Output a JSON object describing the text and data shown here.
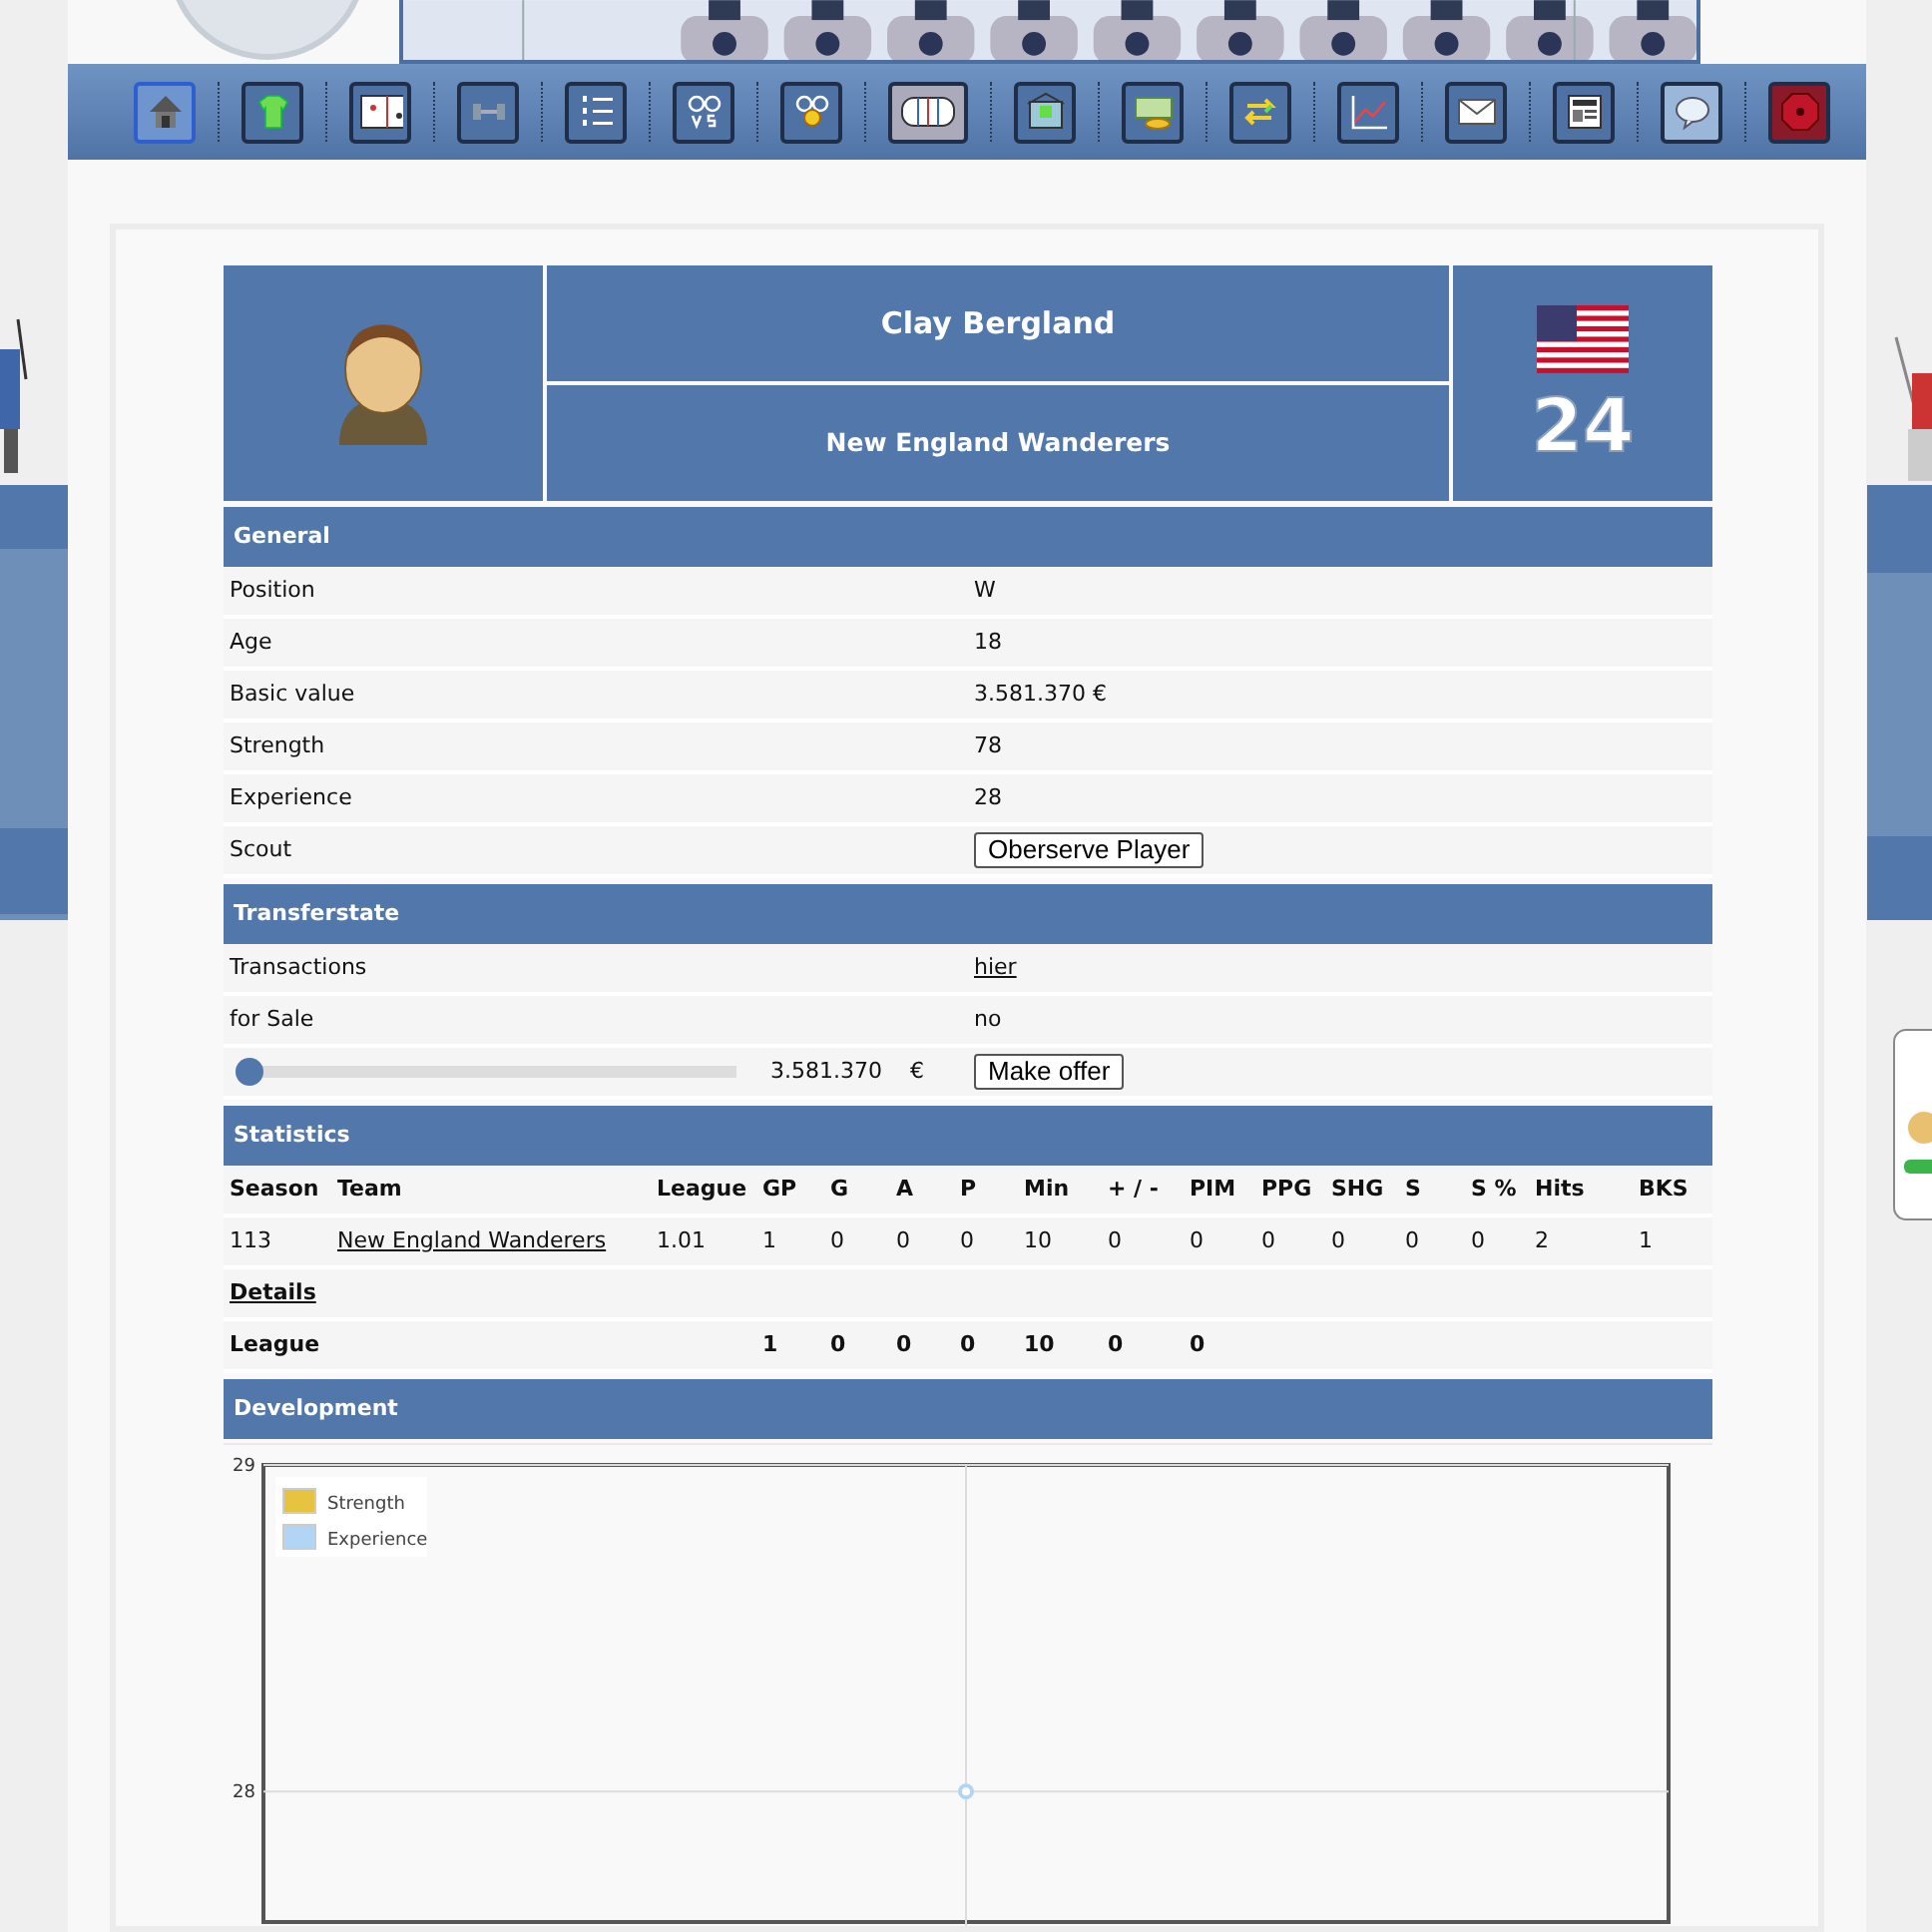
{
  "nav": [
    {
      "selected": true
    },
    {
      "selected": false
    },
    {
      "selected": false
    },
    {
      "selected": false
    },
    {
      "selected": false
    },
    {
      "selected": false
    },
    {
      "selected": false
    },
    {
      "selected": false
    },
    {
      "selected": false
    },
    {
      "selected": false
    },
    {
      "selected": false
    },
    {
      "selected": false
    },
    {
      "selected": false
    },
    {
      "selected": false
    },
    {
      "selected": false
    },
    {
      "selected": false
    }
  ],
  "player": {
    "name": "Clay Bergland",
    "team": "New England Wanderers",
    "number": "24"
  },
  "general": {
    "title": "General",
    "rows": [
      {
        "kind": "text",
        "label": "Position",
        "value": "W"
      },
      {
        "kind": "text",
        "label": "Age",
        "value": "18"
      },
      {
        "kind": "text",
        "label": "Basic value",
        "value": "3.581.370 €"
      },
      {
        "kind": "text",
        "label": "Strength",
        "value": "78"
      },
      {
        "kind": "text",
        "label": "Experience",
        "value": "28"
      },
      {
        "kind": "button",
        "label": "Scout",
        "value": "Oberserve Player"
      }
    ]
  },
  "transfer": {
    "title": "Transferstate",
    "rows": [
      {
        "kind": "link",
        "label": "Transactions",
        "value": "hier"
      },
      {
        "kind": "text",
        "label": "for Sale",
        "value": "no"
      }
    ],
    "offer": {
      "level": 0,
      "amount": "3.581.370",
      "currency": "€",
      "button": "Make offer"
    }
  },
  "statistics": {
    "title": "Statistics",
    "columns": [
      "Season",
      "Team",
      "League",
      "GP",
      "G",
      "A",
      "P",
      "Min",
      "+ / -",
      "PIM",
      "PPG",
      "SHG",
      "S",
      "S %",
      "Hits",
      "BKS"
    ],
    "rows": [
      [
        "113",
        "New England Wanderers",
        "1.01",
        "1",
        "0",
        "0",
        "0",
        "10",
        "0",
        "0",
        "0",
        "0",
        "0",
        "0",
        "2",
        "1"
      ]
    ],
    "details": "Details",
    "total": {
      "label": "League",
      "values": [
        "1",
        "0",
        "0",
        "0",
        "10",
        "0",
        "0"
      ]
    }
  },
  "development": {
    "title": "Development",
    "chart_data": {
      "type": "line",
      "series": [
        {
          "name": "Strength",
          "color": "#e6c440",
          "values": [
            null
          ]
        },
        {
          "name": "Experience",
          "color": "#b3d5f5",
          "values": [
            28
          ],
          "marker": "circle"
        }
      ],
      "ylim": [
        27.6,
        29
      ],
      "yticks": [
        28,
        29
      ]
    }
  }
}
